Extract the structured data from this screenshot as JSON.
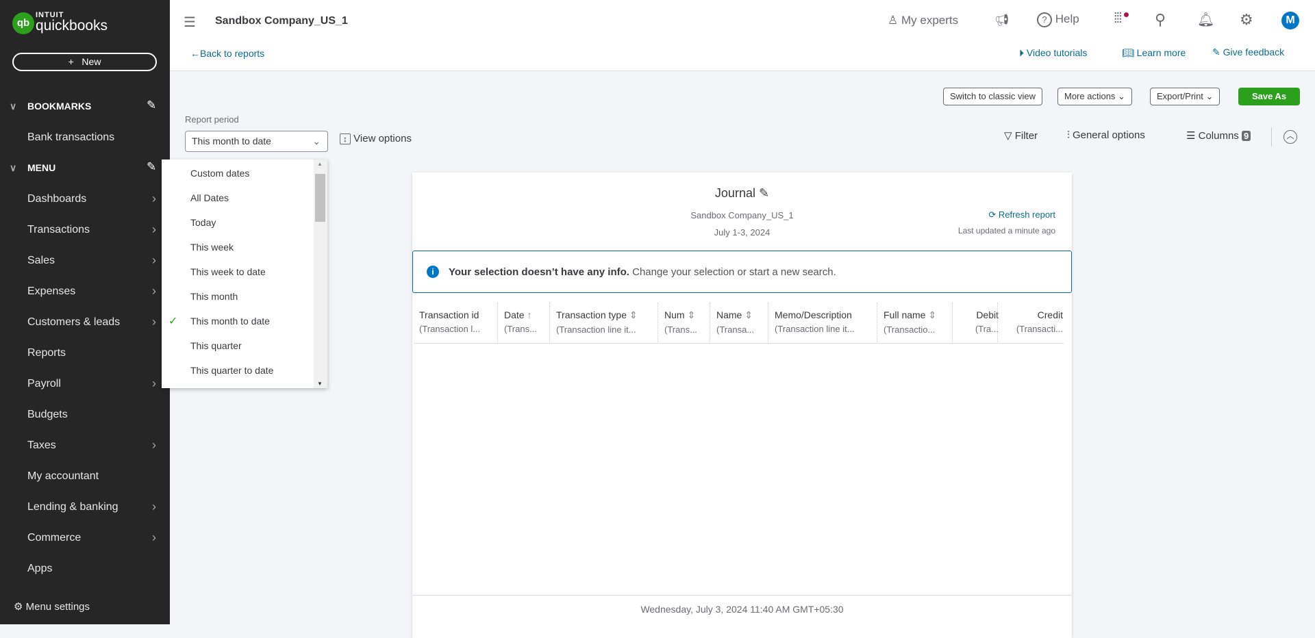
{
  "sidebar": {
    "logo_top": "INTUIT",
    "logo_bottom": "quickbooks",
    "new_label": "New",
    "bookmarks": "BOOKMARKS",
    "bookmark_items": [
      "Bank transactions"
    ],
    "menu": "MENU",
    "menu_items": [
      {
        "label": "Dashboards",
        "arrow": true
      },
      {
        "label": "Transactions",
        "arrow": true
      },
      {
        "label": "Sales",
        "arrow": true
      },
      {
        "label": "Expenses",
        "arrow": true
      },
      {
        "label": "Customers & leads",
        "arrow": true
      },
      {
        "label": "Reports",
        "arrow": false
      },
      {
        "label": "Payroll",
        "arrow": true
      },
      {
        "label": "Budgets",
        "arrow": false
      },
      {
        "label": "Taxes",
        "arrow": true
      },
      {
        "label": "My accountant",
        "arrow": false
      },
      {
        "label": "Lending & banking",
        "arrow": true
      },
      {
        "label": "Commerce",
        "arrow": true
      },
      {
        "label": "Apps",
        "arrow": false
      }
    ],
    "menu_settings": "Menu settings"
  },
  "header": {
    "company": "Sandbox Company_US_1",
    "my_experts": "My experts",
    "help": "Help",
    "avatar": "M",
    "back": "Back to reports",
    "video": "Video tutorials",
    "learn": "Learn more",
    "feedback": "Give feedback"
  },
  "toolbar": {
    "classic": "Switch to classic view",
    "more": "More actions",
    "export": "Export/Print",
    "save": "Save As",
    "report_period_label": "Report period",
    "report_period_value": "This month to date",
    "view_options": "View options",
    "filter": "Filter",
    "general": "General options",
    "columns": "Columns",
    "columns_count": "9"
  },
  "dropdown": {
    "options": [
      "Custom dates",
      "All Dates",
      "Today",
      "This week",
      "This week to date",
      "This month",
      "This month to date",
      "This quarter",
      "This quarter to date"
    ],
    "selected": "This month to date"
  },
  "report": {
    "title": "Journal",
    "company": "Sandbox Company_US_1",
    "date_range": "July 1-3, 2024",
    "refresh": "Refresh report",
    "updated": "Last updated a minute ago",
    "info_bold": "Your selection doesn’t have any info.",
    "info_rest": "Change your selection or start a new search.",
    "columns": [
      {
        "label": "Transaction id",
        "sub": "(Transaction l...",
        "sort": ""
      },
      {
        "label": "Date",
        "sub": "(Trans...",
        "sort": "↑"
      },
      {
        "label": "Transaction type",
        "sub": "(Transaction line it...",
        "sort": "⇕"
      },
      {
        "label": "Num",
        "sub": "(Trans...",
        "sort": "⇕"
      },
      {
        "label": "Name",
        "sub": "(Transa...",
        "sort": "⇕"
      },
      {
        "label": "Memo/Description",
        "sub": "(Transaction line it...",
        "sort": ""
      },
      {
        "label": "Full name",
        "sub": "(Transactio...",
        "sort": "⇕"
      },
      {
        "label": "Debit",
        "sub": "(Tra...",
        "sort": ""
      },
      {
        "label": "Credit",
        "sub": "(Transacti...",
        "sort": ""
      }
    ],
    "footer": "Wednesday, July 3, 2024 11:40 AM GMT+05:30"
  },
  "colors": {
    "sidebar": "#262626",
    "brand_green": "#2ca01c",
    "link": "#0d6b8d",
    "avatar": "#0077c5"
  }
}
